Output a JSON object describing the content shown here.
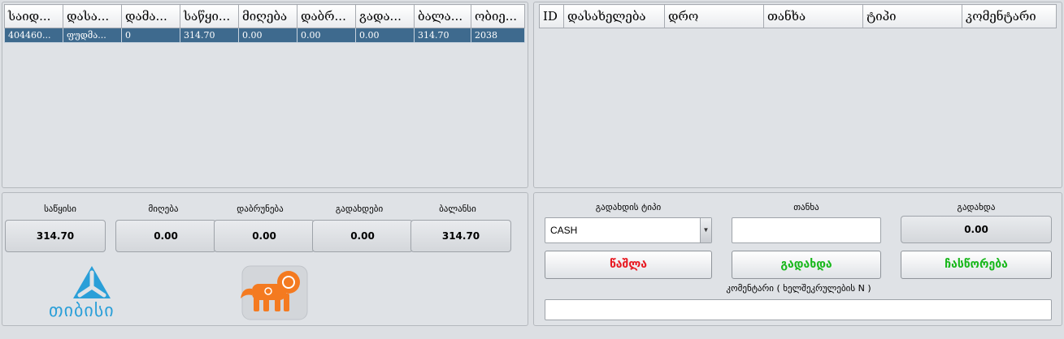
{
  "left_grid": {
    "columns": [
      "საიდ...",
      "დასა...",
      "დამა...",
      "საწყი...",
      "მიღება",
      "დაბრ...",
      "გადა...",
      "ბალა...",
      "ობიე..."
    ],
    "row": [
      "404460...",
      "ფუდმა...",
      "0",
      "314.70",
      "0.00",
      "0.00",
      "0.00",
      "314.70",
      "2038"
    ]
  },
  "right_grid": {
    "columns": [
      "ID",
      "დასახელება",
      "დრო",
      "თანხა",
      "ტიპი",
      "კომენტარი"
    ]
  },
  "summary": {
    "items": [
      {
        "label": "საწყისი",
        "value": "314.70"
      },
      {
        "label": "მიღება",
        "value": "0.00"
      },
      {
        "label": "დაბრუნება",
        "value": "0.00"
      },
      {
        "label": "გადახდები",
        "value": "0.00"
      },
      {
        "label": "ბალანსი",
        "value": "314.70"
      }
    ]
  },
  "logos": {
    "tbc_word": "თიბისი",
    "tbc_color": "#2a9fd8",
    "lion_color": "#f47a20"
  },
  "payment": {
    "type_label": "გადახდის ტიპი",
    "type_value": "CASH",
    "amount_label": "თანხა",
    "paid_label": "გადახდა",
    "paid_value": "0.00",
    "delete_button": "წაშლა",
    "pay_button": "გადახდა",
    "correct_button": "ჩასწორება",
    "comment_label": "კომენტარი ( ხელშეკრულების N )"
  }
}
